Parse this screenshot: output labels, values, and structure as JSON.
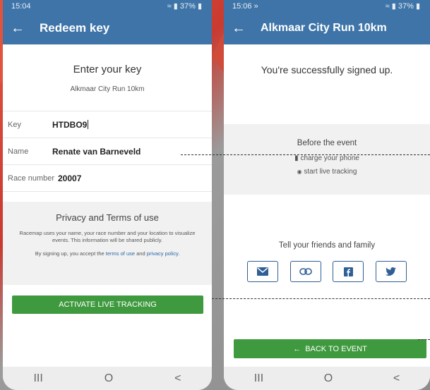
{
  "left": {
    "status": {
      "time": "15:04",
      "right": "37%"
    },
    "title": "Redeem key",
    "heading": "Enter your key",
    "event_name": "Alkmaar City Run 10km",
    "fields": [
      {
        "label": "Key",
        "value": "HTDBO9"
      },
      {
        "label": "Name",
        "value": "Renate van Barneveld"
      },
      {
        "label": "Race number",
        "value": "20007"
      }
    ],
    "privacy": {
      "title": "Privacy and Terms of use",
      "text": "Racemap uses your name, your race number and your location to visualize events. This information will be shared publicly.",
      "accept_prefix": "By signing up, you accept the",
      "terms_link": "terms of use",
      "and": "and",
      "privacy_link": "privacy policy",
      "suffix": "."
    },
    "activate_button": "ACTIVATE LIVE TRACKING"
  },
  "right": {
    "status": {
      "time": "15:06",
      "arrows": "»",
      "right": "37%"
    },
    "title": "Alkmaar City Run 10km",
    "success": "You're successfully signed up.",
    "before": {
      "title": "Before the event",
      "items": [
        "charge your phone",
        "start live tracking"
      ]
    },
    "share_title": "Tell your friends and family",
    "back_button": "BACK TO EVENT"
  },
  "nav": {
    "recent": "III",
    "home": "O",
    "back": "<"
  },
  "icons": [
    "back-arrow-icon",
    "battery-icon",
    "radio-icon",
    "mail-icon",
    "link-icon",
    "facebook-icon",
    "twitter-icon",
    "wifi-icon",
    "signal-icon"
  ],
  "colors": {
    "appbar": "#3e74a8",
    "green": "#3f9a3f",
    "share_border": "#2f5f95",
    "link": "#2a67a8"
  }
}
